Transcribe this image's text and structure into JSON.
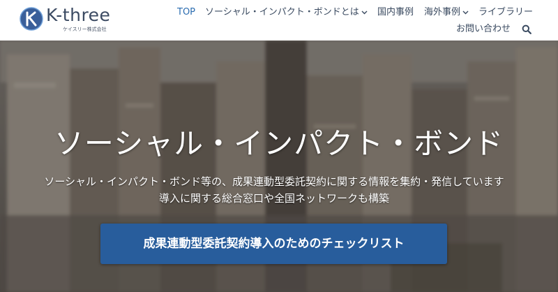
{
  "brand": {
    "name": "K-three",
    "sub": "ケイスリー株式会社",
    "icon": "k-three-logo-icon",
    "color": "#3b4a62"
  },
  "nav": {
    "items": [
      {
        "label": "TOP",
        "active": true
      },
      {
        "label": "ソーシャル・インパクト・ボンドとは",
        "dropdown": true
      },
      {
        "label": "国内事例"
      },
      {
        "label": "海外事例",
        "dropdown": true
      },
      {
        "label": "ライブラリー"
      },
      {
        "label": "お問い合わせ"
      }
    ],
    "search_icon": "search-icon",
    "active_color": "#2b6cb0"
  },
  "hero": {
    "title": "ソーシャル・インパクト・ボンド",
    "subtitle_line1": "ソーシャル・インパクト・ボンド等の、成果連動型委託契約に関する情報を集約・発信しています",
    "subtitle_line2": "導入に関する総合窓口や全国ネットワークも構築",
    "cta_label": "成果連動型委託契約導入のためのチェックリスト",
    "cta_color": "#285d9c",
    "background": "city-skyline-photo"
  }
}
